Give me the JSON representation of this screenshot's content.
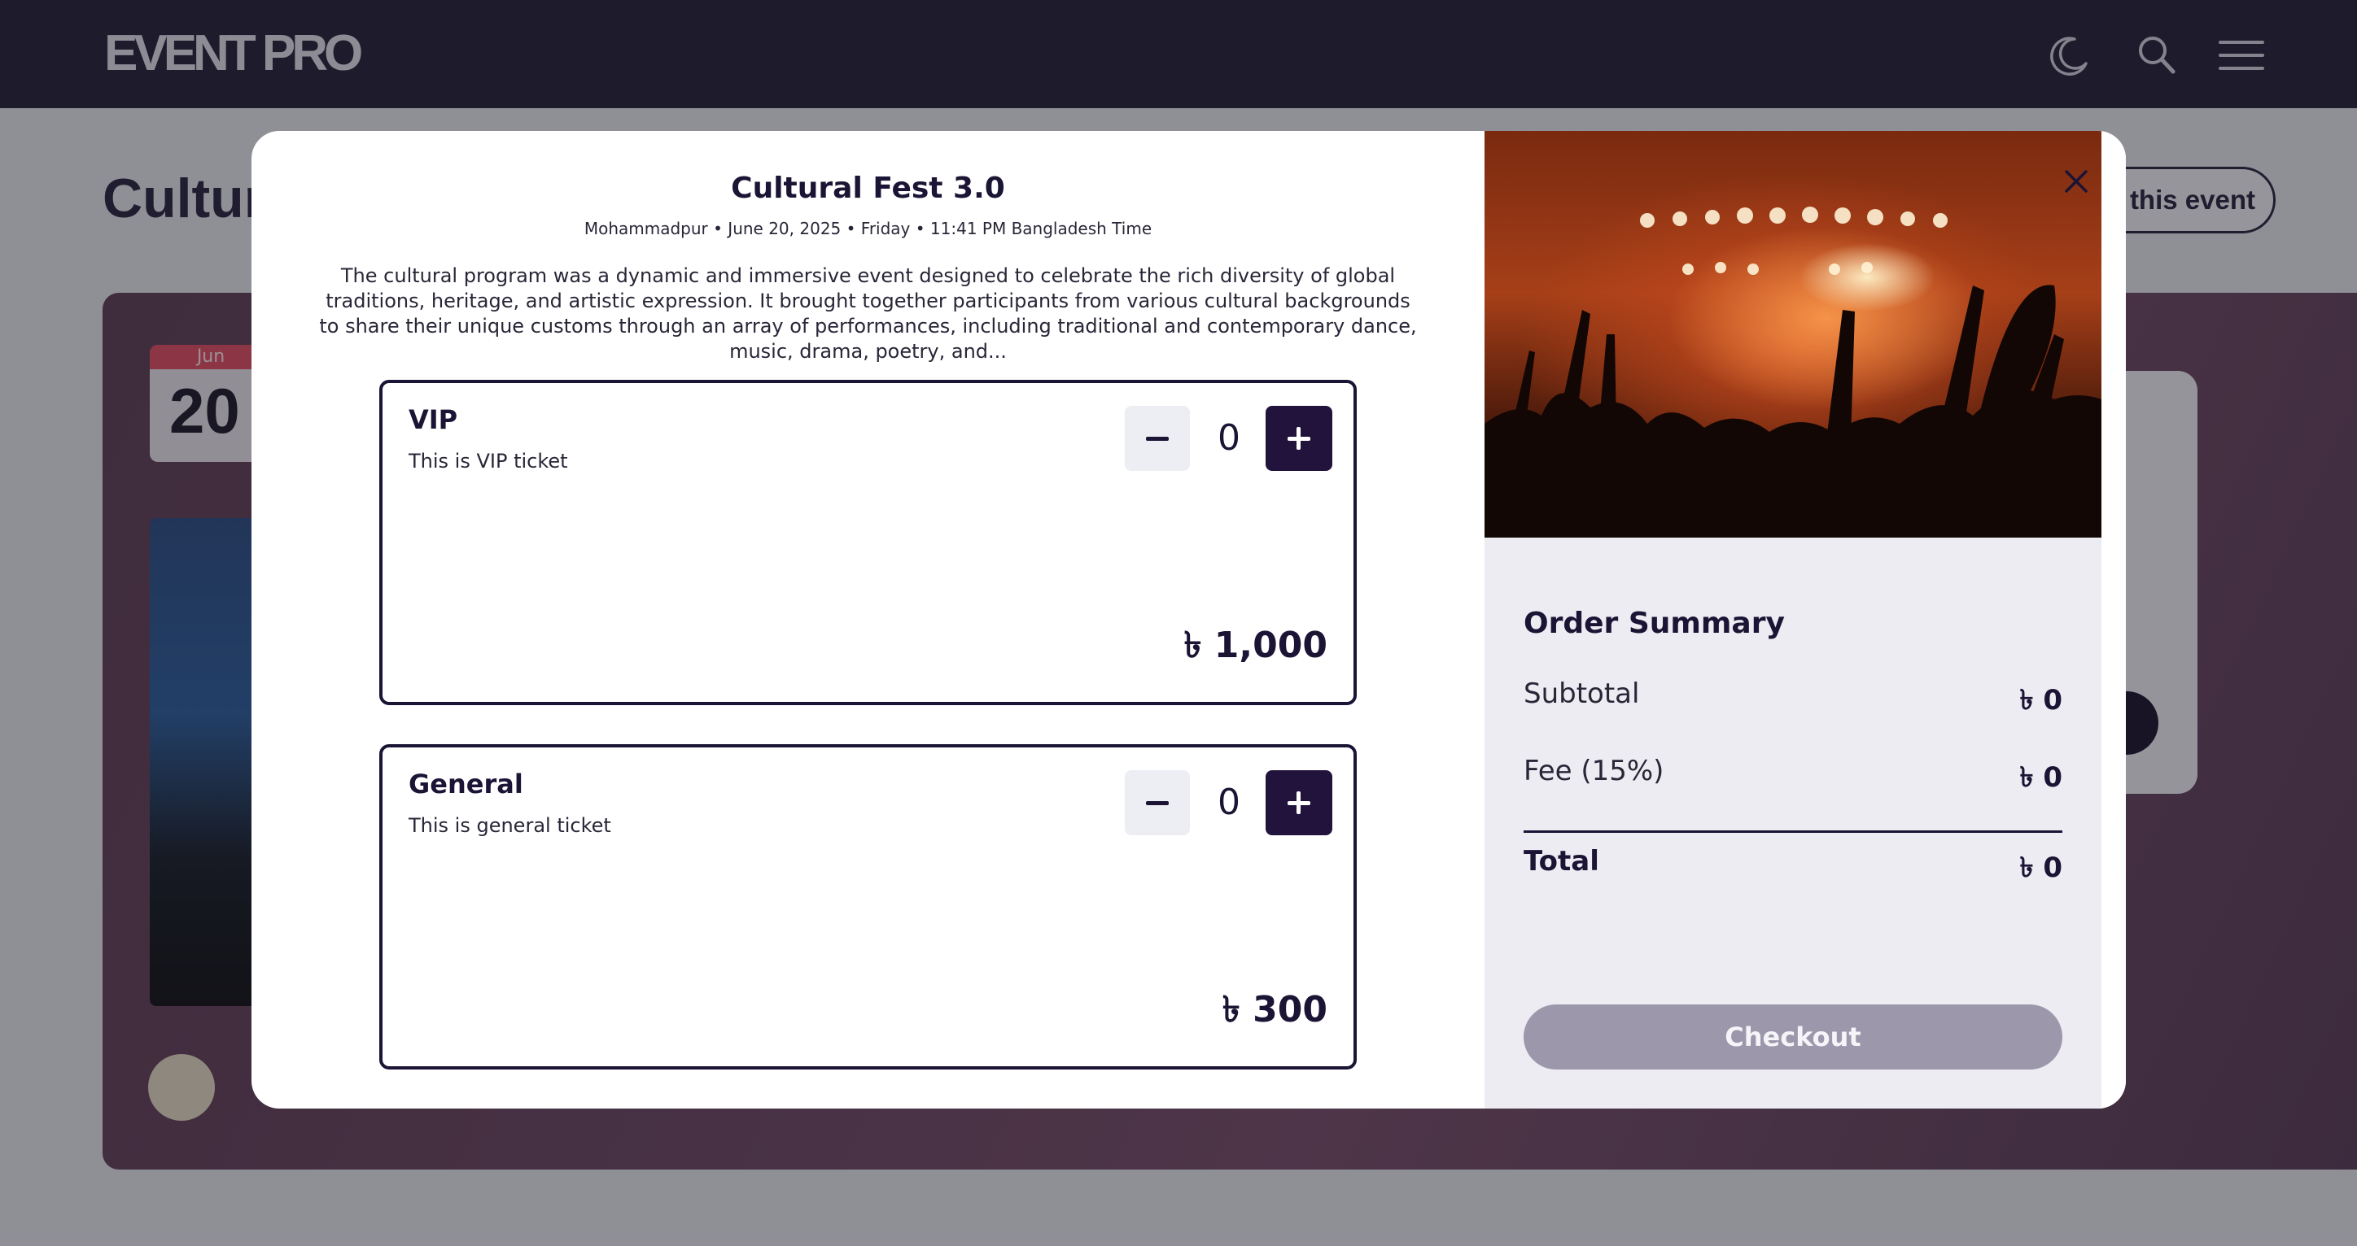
{
  "header": {
    "logo": "EVENT PRO",
    "icons": [
      "moon-icon",
      "search-icon",
      "menu-icon"
    ]
  },
  "background_page": {
    "title": "Cultur",
    "share_label": "e this event",
    "date_month": "Jun",
    "date_day": "20"
  },
  "modal": {
    "event_title": "Cultural Fest 3.0",
    "event_meta": "Mohammadpur • June 20, 2025 • Friday • 11:41 PM Bangladesh Time",
    "event_description": "The cultural program was a dynamic and immersive event designed to celebrate the rich diversity of global traditions, heritage, and artistic expression. It brought together participants from various cultural backgrounds to share their unique customs through an array of performances, including traditional and contemporary dance, music, drama, poetry, and...",
    "tickets": [
      {
        "name": "VIP",
        "description": "This is VIP ticket",
        "quantity": "0",
        "price": "৳ 1,000"
      },
      {
        "name": "General",
        "description": "This is general ticket",
        "quantity": "0",
        "price": "৳ 300"
      }
    ],
    "order_summary": {
      "title": "Order Summary",
      "subtotal_label": "Subtotal",
      "subtotal_value": "৳ 0",
      "fee_label": "Fee (15%)",
      "fee_value": "৳ 0",
      "total_label": "Total",
      "total_value": "৳ 0",
      "checkout_label": "Checkout"
    }
  },
  "colors": {
    "topbar": "#262339",
    "primary_dark": "#22133d",
    "checkout_disabled": "#9d97ab",
    "summary_bg": "#ececf2"
  }
}
